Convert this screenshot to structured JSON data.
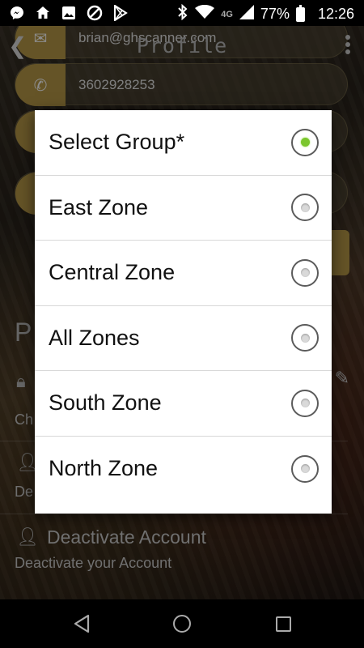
{
  "status_bar": {
    "battery_percent": "77%",
    "time": "12:26",
    "network": "4G",
    "left_icons": [
      "messenger-icon",
      "home-icon",
      "image-icon",
      "blocked-icon",
      "play-store-icon"
    ],
    "right_icons": [
      "bluetooth-icon",
      "wifi-icon",
      "signal-icon",
      "battery-icon"
    ]
  },
  "app_bar": {
    "title": "Profile"
  },
  "background": {
    "email": "brian@ghscanner.com",
    "phone": "3602928253",
    "section_letter": "P",
    "row_partial_1": "Ch",
    "row_partial_2": "De",
    "deactivate_title": "Deactivate Account",
    "deactivate_subtitle": "Deactivate your Account"
  },
  "dialog": {
    "options": [
      {
        "label": "Select Group*",
        "selected": true
      },
      {
        "label": "East Zone",
        "selected": false
      },
      {
        "label": "Central Zone",
        "selected": false
      },
      {
        "label": "All Zones",
        "selected": false
      },
      {
        "label": "South Zone",
        "selected": false
      },
      {
        "label": "North Zone",
        "selected": false
      }
    ]
  },
  "colors": {
    "radio_selected": "#7bc62d",
    "accent_gold": "#b89a48"
  }
}
